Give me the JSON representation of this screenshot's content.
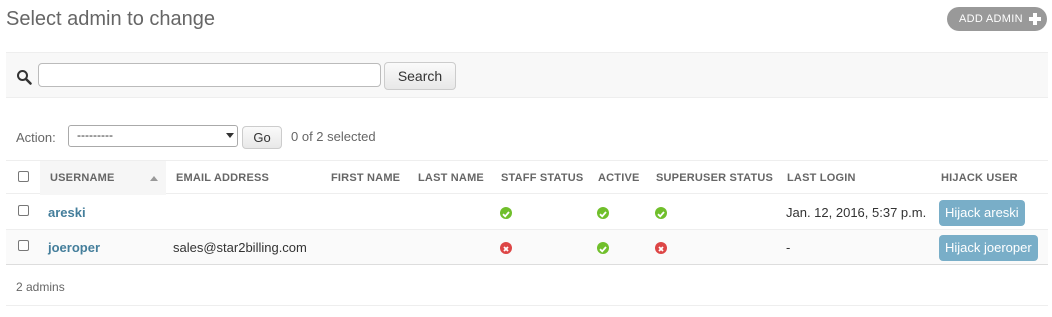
{
  "header": {
    "title": "Select admin to change",
    "add_label": "ADD ADMIN"
  },
  "search": {
    "value": "",
    "button_label": "Search"
  },
  "actions": {
    "label": "Action:",
    "selected_option": "---------",
    "go_label": "Go",
    "selected_text": "0 of 2 selected"
  },
  "table": {
    "columns": [
      "USERNAME",
      "EMAIL ADDRESS",
      "FIRST NAME",
      "LAST NAME",
      "STAFF STATUS",
      "ACTIVE",
      "SUPERUSER STATUS",
      "LAST LOGIN",
      "HIJACK USER"
    ],
    "sorted_column": "USERNAME",
    "rows": [
      {
        "username": "areski",
        "email": "",
        "first_name": "",
        "last_name": "",
        "staff_status": true,
        "active": true,
        "superuser_status": true,
        "last_login": "Jan. 12, 2016, 5:37 p.m.",
        "hijack_label": "Hijack areski"
      },
      {
        "username": "joeroper",
        "email": "sales@star2billing.com",
        "first_name": "",
        "last_name": "",
        "staff_status": false,
        "active": true,
        "superuser_status": false,
        "last_login": "-",
        "hijack_label": "Hijack joeroper"
      }
    ]
  },
  "footer": {
    "count_text": "2 admins"
  },
  "colors": {
    "link": "#447e9b",
    "yes": "#70bf2b",
    "no": "#dd4646",
    "hijack": "#79aec8"
  },
  "icons": {
    "search": "search-icon",
    "add": "plus-icon",
    "yes": "check-circle-icon",
    "no": "x-circle-icon"
  }
}
